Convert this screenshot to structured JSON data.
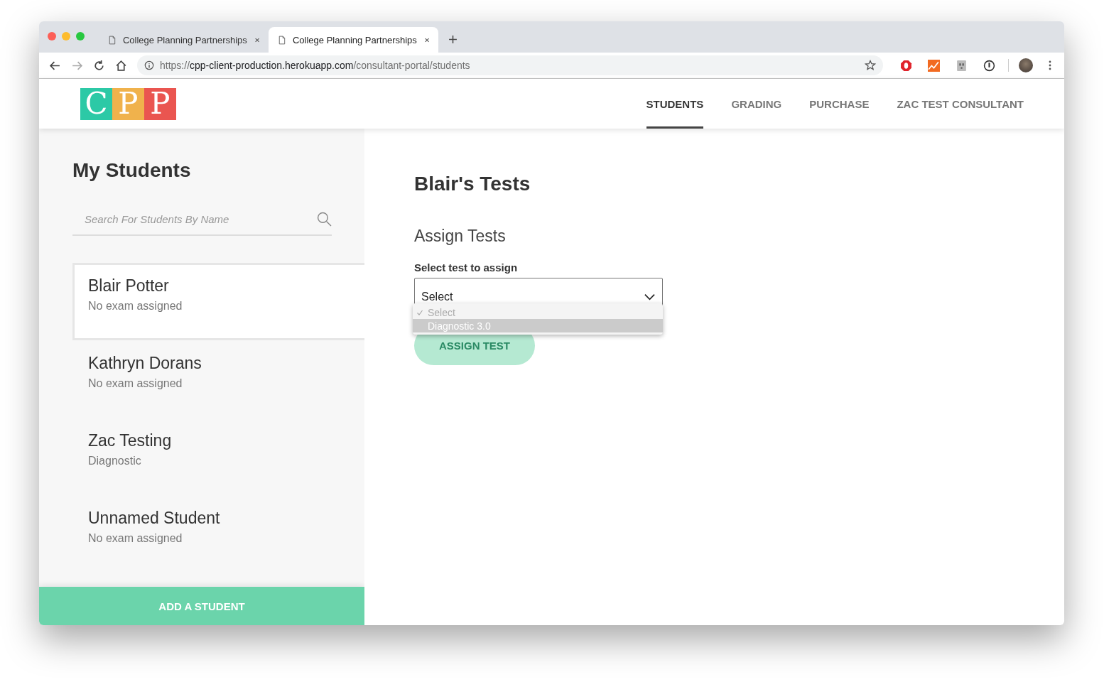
{
  "browser": {
    "tabs": [
      {
        "title": "College Planning Partnerships",
        "selected": false
      },
      {
        "title": "College Planning Partnerships",
        "selected": true
      }
    ],
    "url": {
      "scheme": "https://",
      "host": "cpp-client-production.herokuapp.com",
      "path": "/consultant-portal/students"
    }
  },
  "logo": [
    "C",
    "P",
    "P"
  ],
  "nav": [
    {
      "label": "STUDENTS",
      "selected": true
    },
    {
      "label": "GRADING",
      "selected": false
    },
    {
      "label": "PURCHASE",
      "selected": false
    },
    {
      "label": "ZAC TEST CONSULTANT",
      "selected": false
    }
  ],
  "sidebar": {
    "title": "My Students",
    "search": {
      "placeholder": "Search For Students By Name"
    },
    "students": [
      {
        "name": "Blair Potter",
        "status": "No exam assigned",
        "selected": true
      },
      {
        "name": "Kathryn Dorans",
        "status": "No exam assigned",
        "selected": false
      },
      {
        "name": "Zac Testing",
        "status": "Diagnostic",
        "selected": false
      },
      {
        "name": "Unnamed Student",
        "status": "No exam assigned",
        "selected": false
      }
    ],
    "add_button": "ADD A STUDENT"
  },
  "main": {
    "title": "Blair's Tests",
    "section": "Assign Tests",
    "select": {
      "label": "Select test to assign",
      "value": "Select",
      "open": true,
      "options": [
        {
          "label": "Select",
          "selected": true,
          "highlighted": false
        },
        {
          "label": "Diagnostic 3.0",
          "selected": false,
          "highlighted": true
        }
      ]
    },
    "assign_button": {
      "label": "ASSIGN TEST",
      "disabled": true
    }
  }
}
